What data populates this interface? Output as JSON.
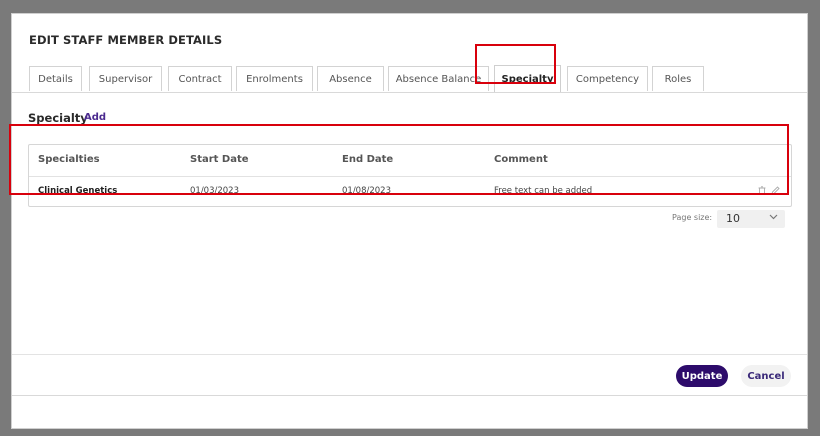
{
  "modal": {
    "title": "EDIT STAFF MEMBER DETAILS"
  },
  "tabs": [
    {
      "label": "Details"
    },
    {
      "label": "Supervisor"
    },
    {
      "label": "Contract"
    },
    {
      "label": "Enrolments"
    },
    {
      "label": "Absence"
    },
    {
      "label": "Absence Balance"
    },
    {
      "label": "Specialty"
    },
    {
      "label": "Competency"
    },
    {
      "label": "Roles"
    }
  ],
  "active_tab": "Specialty",
  "section": {
    "title": "Specialty",
    "add_label": "Add"
  },
  "table": {
    "columns": [
      "Specialties",
      "Start Date",
      "End Date",
      "Comment"
    ],
    "rows": [
      {
        "specialty": "Clinical Genetics",
        "start_date": "01/03/2023",
        "end_date": "01/08/2023",
        "comment": "Free text can be added"
      }
    ]
  },
  "pagination": {
    "page_size_label": "Page size:",
    "page_size": "10"
  },
  "footer": {
    "update_label": "Update",
    "cancel_label": "Cancel"
  },
  "colors": {
    "primary": "#2d0b6b",
    "highlight": "#d8000c",
    "link": "#4b2a8f"
  },
  "icons": {
    "delete": "trash-icon",
    "edit": "pencil-icon",
    "dropdown": "chevron-down-icon"
  }
}
